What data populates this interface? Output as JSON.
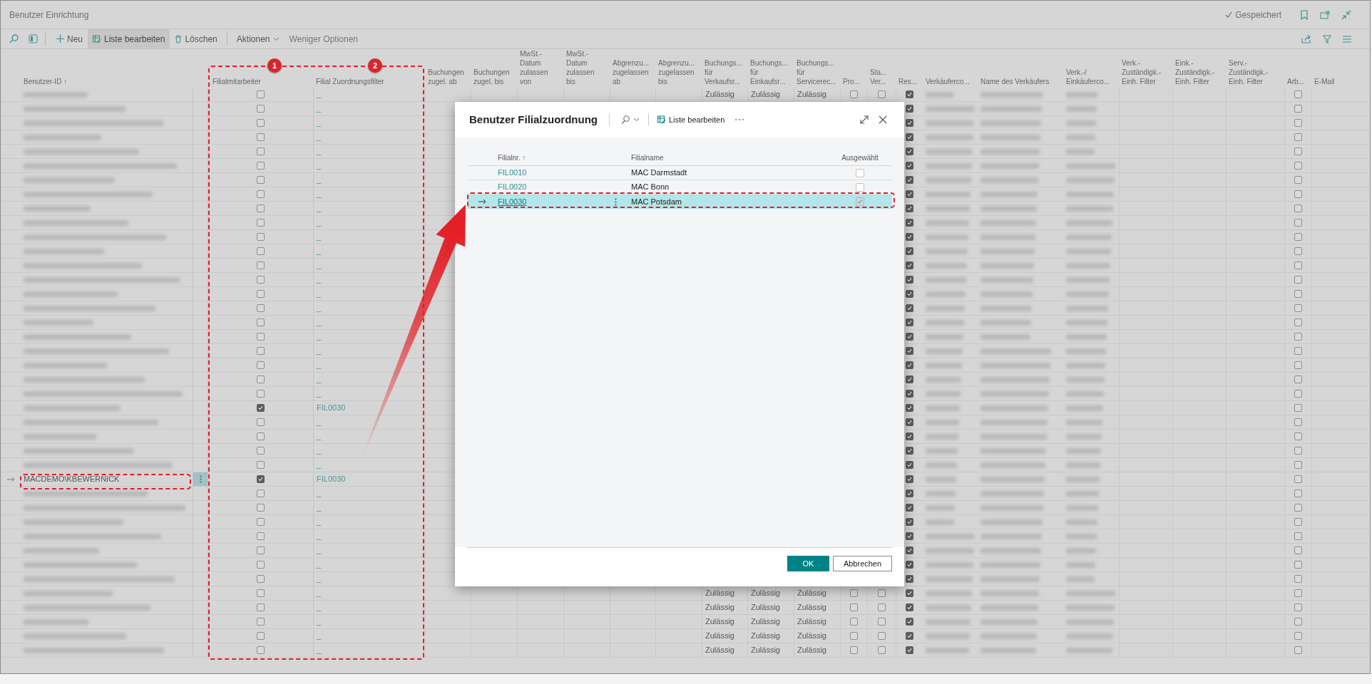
{
  "window": {
    "title": "Benutzer Einrichtung",
    "status": "Gespeichert"
  },
  "toolbar": {
    "actions": [
      {
        "label": "Neu",
        "kind": "new",
        "active": false
      },
      {
        "label": "Liste bearbeiten",
        "kind": "edit",
        "active": true
      },
      {
        "label": "Löschen",
        "kind": "delete",
        "active": false
      },
      {
        "label": "Aktionen",
        "kind": "menu",
        "active": false
      },
      {
        "label": "Weniger Optionen",
        "kind": "plain",
        "active": false
      }
    ]
  },
  "table": {
    "columns": [
      "Benutzer-ID ↑",
      "Filialmitarbeiter",
      "Filial Zuordnungsfilter",
      "Buchungen\nzugel. ab",
      "Buchungen\nzugel. bis",
      "MwSt.-\nDatum\nzulassen\nvon",
      "MwSt.-\nDatum\nzulassen\nbis",
      "Abgrenzu...\nzugelassen\nab",
      "Abgrenzu...\nzugelassen\nbis",
      "Buchungs...\nfür\nVerkaufsr...",
      "Buchungs...\nfür\nEinkaufsr...",
      "Buchungs...\nfür\nServicerec...",
      "Pro...",
      "Sta...\nVer...",
      "Res...",
      "Verkäuferco...",
      "Name des Verkäufers",
      "Verk.-/\nEinkäuferco...",
      "Verk.-\nZuständigk.-\nEinh. Filter",
      "Eink.-\nZuständigk.-\nEinh. Filter",
      "Serv.-\nZuständigk.-\nEinh. Filter",
      "Arb...",
      "E-Mail"
    ],
    "rows": [
      {
        "selected": false,
        "filialmitarbeiter": false,
        "filter": "_",
        "posting": [
          "Zulässig",
          "Zulässig",
          "Zulässig"
        ],
        "pro": false,
        "sta": false,
        "res": true,
        "arb": false
      },
      {
        "selected": false,
        "filialmitarbeiter": false,
        "filter": "_",
        "res": true,
        "arb": false
      },
      {
        "selected": false,
        "filialmitarbeiter": false,
        "filter": "_",
        "res": true,
        "arb": false
      },
      {
        "selected": false,
        "filialmitarbeiter": false,
        "filter": "_",
        "res": true,
        "arb": false
      },
      {
        "selected": false,
        "filialmitarbeiter": false,
        "filter": "_",
        "res": true,
        "arb": false
      },
      {
        "selected": false,
        "filialmitarbeiter": false,
        "filter": "_",
        "res": true,
        "arb": false
      },
      {
        "selected": false,
        "filialmitarbeiter": false,
        "filter": "_",
        "res": true,
        "arb": false
      },
      {
        "selected": false,
        "filialmitarbeiter": false,
        "filter": "_",
        "res": true,
        "arb": false
      },
      {
        "selected": false,
        "filialmitarbeiter": false,
        "filter": "_",
        "res": true,
        "arb": false
      },
      {
        "selected": false,
        "filialmitarbeiter": false,
        "filter": "_",
        "res": true,
        "arb": false
      },
      {
        "selected": false,
        "filialmitarbeiter": false,
        "filter": "_",
        "res": true,
        "arb": false
      },
      {
        "selected": false,
        "filialmitarbeiter": false,
        "filter": "_",
        "res": true,
        "arb": false
      },
      {
        "selected": false,
        "filialmitarbeiter": false,
        "filter": "_",
        "res": true,
        "arb": false
      },
      {
        "selected": false,
        "filialmitarbeiter": false,
        "filter": "_",
        "res": true,
        "arb": false
      },
      {
        "selected": false,
        "filialmitarbeiter": false,
        "filter": "_",
        "res": true,
        "arb": false
      },
      {
        "selected": false,
        "filialmitarbeiter": false,
        "filter": "_",
        "res": true,
        "arb": false
      },
      {
        "selected": false,
        "filialmitarbeiter": false,
        "filter": "_",
        "res": true,
        "arb": false
      },
      {
        "selected": false,
        "filialmitarbeiter": false,
        "filter": "_",
        "res": true,
        "arb": false
      },
      {
        "selected": false,
        "filialmitarbeiter": false,
        "filter": "_",
        "res": true,
        "arb": false
      },
      {
        "selected": false,
        "filialmitarbeiter": false,
        "filter": "_",
        "res": true,
        "arb": false
      },
      {
        "selected": false,
        "filialmitarbeiter": false,
        "filter": "_",
        "res": true,
        "arb": false
      },
      {
        "selected": false,
        "filialmitarbeiter": false,
        "filter": "_",
        "res": true,
        "arb": false
      },
      {
        "selected": false,
        "filialmitarbeiter": true,
        "filter": "FIL0030",
        "res": true,
        "arb": false
      },
      {
        "selected": false,
        "filialmitarbeiter": false,
        "filter": "_",
        "res": true,
        "arb": false
      },
      {
        "selected": false,
        "filialmitarbeiter": false,
        "filter": "_",
        "res": true,
        "arb": false
      },
      {
        "selected": false,
        "filialmitarbeiter": false,
        "filter": "_",
        "res": true,
        "arb": false
      },
      {
        "selected": false,
        "filialmitarbeiter": false,
        "filter": "_",
        "res": true,
        "arb": false
      },
      {
        "selected": true,
        "user_id": "MACDEMO\\KBEWERNICK",
        "filialmitarbeiter": true,
        "filter": "FIL0030",
        "res": true,
        "arb": false
      },
      {
        "selected": false,
        "filialmitarbeiter": false,
        "filter": "_",
        "res": true,
        "arb": false
      },
      {
        "selected": false,
        "filialmitarbeiter": false,
        "filter": "_",
        "res": true,
        "arb": false
      },
      {
        "selected": false,
        "filialmitarbeiter": false,
        "filter": "_",
        "res": true,
        "arb": false
      },
      {
        "selected": false,
        "filialmitarbeiter": false,
        "filter": "_",
        "res": true,
        "arb": false
      },
      {
        "selected": false,
        "filialmitarbeiter": false,
        "filter": "_",
        "res": true,
        "arb": false
      },
      {
        "selected": false,
        "filialmitarbeiter": false,
        "filter": "_",
        "res": true,
        "arb": false
      },
      {
        "selected": false,
        "filialmitarbeiter": false,
        "filter": "_",
        "res": true,
        "arb": false
      },
      {
        "selected": false,
        "filialmitarbeiter": false,
        "filter": "_",
        "posting": [
          "Zulässig",
          "Zulässig",
          "Zulässig"
        ],
        "pro": false,
        "sta": false,
        "res": true,
        "arb": false
      },
      {
        "selected": false,
        "filialmitarbeiter": false,
        "filter": "_",
        "posting": [
          "Zulässig",
          "Zulässig",
          "Zulässig"
        ],
        "pro": false,
        "sta": false,
        "res": true,
        "arb": false
      },
      {
        "selected": false,
        "filialmitarbeiter": false,
        "filter": "_",
        "posting": [
          "Zulässig",
          "Zulässig",
          "Zulässig"
        ],
        "pro": false,
        "sta": false,
        "res": true,
        "arb": false
      },
      {
        "selected": false,
        "filialmitarbeiter": false,
        "filter": "_",
        "posting": [
          "Zulässig",
          "Zulässig",
          "Zulässig"
        ],
        "pro": false,
        "sta": false,
        "res": true,
        "arb": false
      },
      {
        "selected": false,
        "filialmitarbeiter": false,
        "filter": "_",
        "posting": [
          "Zulässig",
          "Zulässig",
          "Zulässig"
        ],
        "pro": false,
        "sta": false,
        "res": true,
        "arb": false
      }
    ]
  },
  "dialog": {
    "title": "Benutzer Filialzuordnung",
    "action": "Liste bearbeiten",
    "columns": [
      "Filialnr. ↑",
      "Filialname",
      "Ausgewählt"
    ],
    "rows": [
      {
        "number": "FIL0010",
        "name": "MAC Darmstadt",
        "checked": false,
        "selected": false
      },
      {
        "number": "FIL0020",
        "name": "MAC Bonn",
        "checked": false,
        "selected": false
      },
      {
        "number": "FIL0030",
        "name": "MAC Potsdam",
        "checked": true,
        "selected": true
      }
    ],
    "buttons": [
      {
        "label": "OK",
        "kind": "primary"
      },
      {
        "label": "Abbrechen",
        "kind": "secondary"
      }
    ]
  },
  "annotations": {
    "badges": [
      "1",
      "2"
    ]
  }
}
